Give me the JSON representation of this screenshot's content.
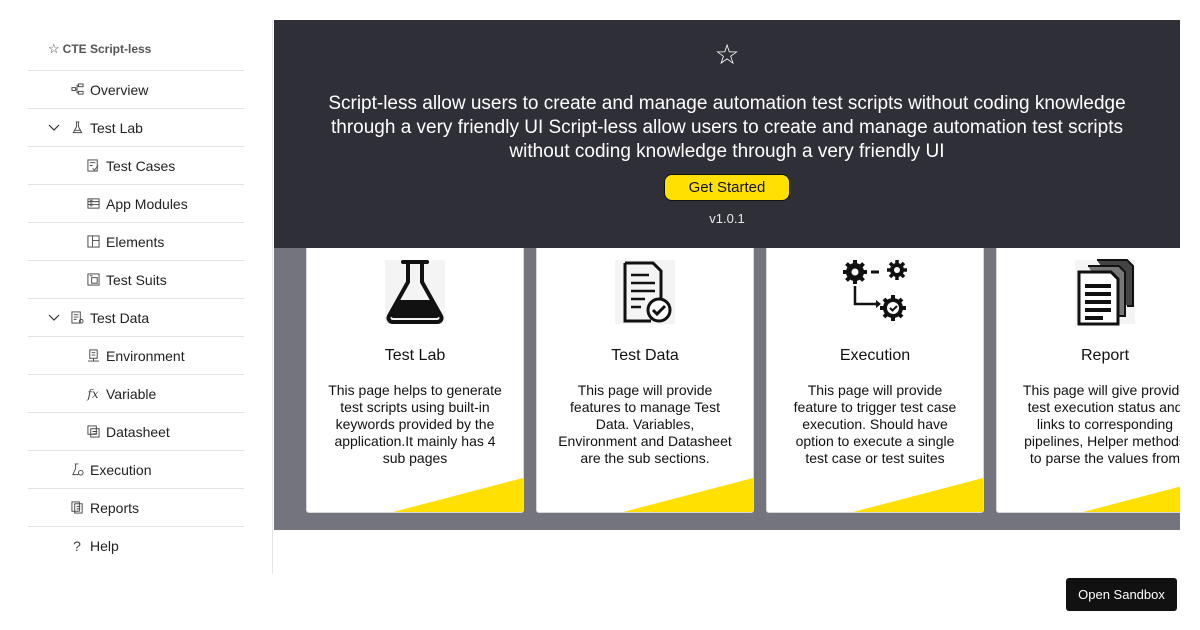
{
  "sidebar": {
    "brand": "CTE Script-less",
    "items": [
      {
        "label": "Overview"
      },
      {
        "label": "Test Lab"
      },
      {
        "label": "Test Cases"
      },
      {
        "label": "App Modules"
      },
      {
        "label": "Elements"
      },
      {
        "label": "Test Suits"
      },
      {
        "label": "Test Data"
      },
      {
        "label": "Environment"
      },
      {
        "label": "Variable"
      },
      {
        "label": "Datasheet"
      },
      {
        "label": "Execution"
      },
      {
        "label": "Reports"
      },
      {
        "label": "Help"
      }
    ]
  },
  "hero": {
    "text": "Script-less allow users to create and manage automation test scripts without coding knowledge through a very friendly UI Script-less allow users to create and manage automation test scripts without coding knowledge through a very friendly UI",
    "cta_label": "Get Started",
    "version": "v1.0.1"
  },
  "cards": [
    {
      "title": "Test Lab",
      "icon": "flask-icon",
      "desc": "This page helps to generate test scripts using built-in keywords provided by the application.It mainly has 4 sub pages"
    },
    {
      "title": "Test Data",
      "icon": "document-check-icon",
      "desc": "This page will provide features to manage Test Data. Variables, Environment and Datasheet are the sub sections."
    },
    {
      "title": "Execution",
      "icon": "gears-flow-icon",
      "desc": "This page will provide feature to trigger test case execution. Should have option to execute a single test case or test suites"
    },
    {
      "title": "Report",
      "icon": "report-pages-icon",
      "desc": "This page will give provide test execution status and links to corresponding pipelines, Helper methods to parse the values from"
    }
  ],
  "sandbox_label": "Open Sandbox",
  "colors": {
    "hero_bg": "#2f2f37",
    "band_bg": "#74747e",
    "accent": "#ffe000",
    "sandbox_bg": "#111111"
  }
}
